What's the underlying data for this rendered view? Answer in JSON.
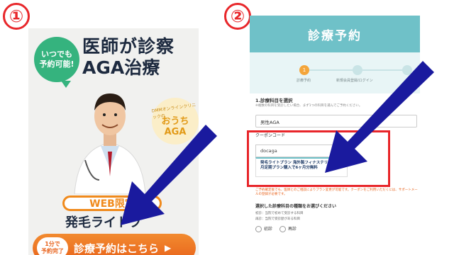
{
  "steps": [
    "①",
    "②"
  ],
  "left": {
    "bubble": [
      "いつでも",
      "予約可能!"
    ],
    "title_line1": "医師が診察",
    "title_line2": "AGA治療",
    "stamp_sub": "DMMオンラインクリニックの",
    "stamp_main": "おうち\nAGA",
    "web_tag": "WEB限定",
    "headline": "発毛ライトプ",
    "cta_badge": [
      "1分で",
      "予約完了"
    ],
    "cta_label": "診療予約はこちら",
    "cta_chevron": "▶"
  },
  "right": {
    "hero_title": "診療予約",
    "steps": [
      {
        "num": "1",
        "label": "診療予約"
      },
      {
        "num": "",
        "label": "新規会員登録/ログイン"
      },
      {
        "num": "",
        "label": ""
      }
    ],
    "section1_title": "1.診療科目を選択",
    "section1_note": "※複数の科目を受診したい場合、まず1つの科目を選んでご予約ください。",
    "select_value": "男性AGA",
    "coupon_label": "クーポンコード",
    "coupon_value": "docaga",
    "coupon_result": "発毛ライトプラン 海外製フィナステリド12ヶ月定期プラン購入で6ヶ月分無料",
    "warning": "ご予約確定後でも、医師とのご相談によりプラン変更が可能です。クーポンをご利用いただくには、サポートメールの登録が必要です。",
    "section2_title": "選択した診療科目の種類をお選びください",
    "section2_lines": [
      "初診：当院で初めて受診する科目",
      "再診：当院で受診歴がある科目"
    ],
    "radio_options": [
      "初診",
      "再診"
    ]
  },
  "colors": {
    "accent_red": "#e8262a",
    "orange": "#e8621b",
    "teal": "#6fc1c8",
    "arrow": "#1a1a9e"
  }
}
